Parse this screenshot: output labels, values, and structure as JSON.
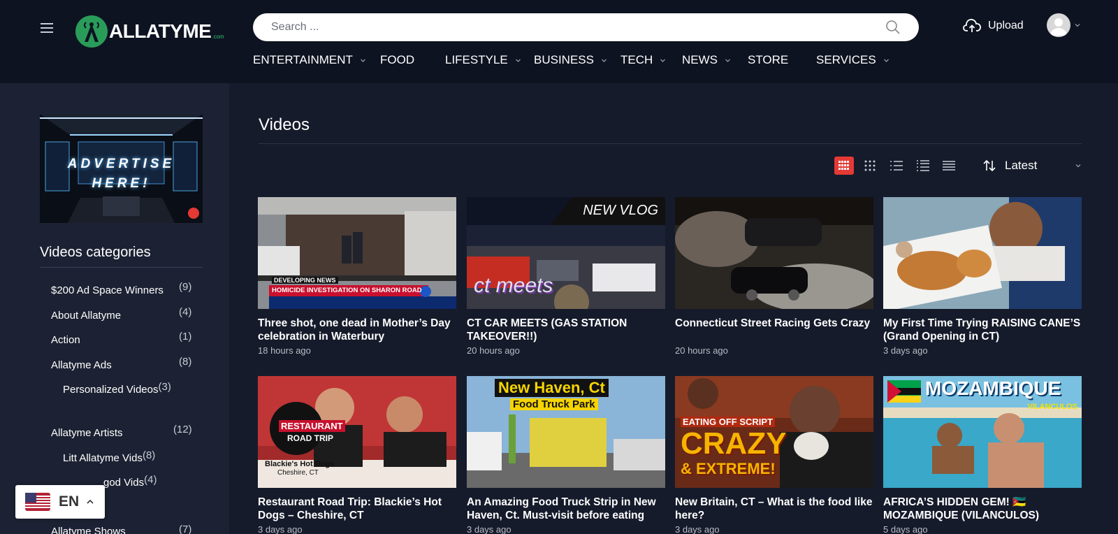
{
  "header": {
    "logo_text": "ALLATYME",
    "logo_suffix": ".com",
    "search_placeholder": "Search ...",
    "upload_label": "Upload"
  },
  "nav": [
    {
      "label": "ENTERTAINMENT",
      "has_dropdown": true
    },
    {
      "label": "FOOD",
      "has_dropdown": false
    },
    {
      "label": "LIFESTYLE",
      "has_dropdown": true
    },
    {
      "label": "BUSINESS",
      "has_dropdown": true
    },
    {
      "label": "TECH",
      "has_dropdown": true
    },
    {
      "label": "NEWS",
      "has_dropdown": true
    },
    {
      "label": "STORE",
      "has_dropdown": false
    },
    {
      "label": "SERVICES",
      "has_dropdown": true
    }
  ],
  "sidebar": {
    "ad_text_line1": "ADVERTISE",
    "ad_text_line2": "HERE!",
    "categories_title": "Videos categories",
    "categories": [
      {
        "label": "$200 Ad Space Winners",
        "count": "(9)"
      },
      {
        "label": "About Allatyme",
        "count": "(4)"
      },
      {
        "label": "Action",
        "count": "(1)"
      },
      {
        "label": "Allatyme Ads",
        "count": "(8)"
      },
      {
        "label": "Personalized Videos",
        "count": "(3)"
      },
      {
        "label": "Allatyme Artists",
        "count": "(12)"
      },
      {
        "label": "Litt Allatyme Vids",
        "count": "(8)"
      },
      {
        "label": "god Vids",
        "count": "(4)"
      },
      {
        "label": "Allatyme Shows",
        "count": "(7)"
      }
    ]
  },
  "main": {
    "title": "Videos",
    "sort_label": "Latest",
    "videos": [
      {
        "title": "Three shot, one dead in Mother’s Day celebration in Waterbury",
        "time": "18 hours ago"
      },
      {
        "title": "CT CAR MEETS (GAS STATION TAKEOVER!!)",
        "time": "20 hours ago"
      },
      {
        "title": "Connecticut Street Racing Gets Crazy",
        "time": "20 hours ago"
      },
      {
        "title": "My First Time Trying RAISING CANE’S (Grand Opening in CT)",
        "time": "3 days ago"
      },
      {
        "title": "Restaurant Road Trip: Blackie’s Hot Dogs – Cheshire, CT",
        "time": "3 days ago"
      },
      {
        "title": "An Amazing Food Truck Strip in New Haven, Ct. Must-visit before eating th…",
        "time": "3 days ago"
      },
      {
        "title": "New Britain, CT – What is the food like here?",
        "time": "3 days ago"
      },
      {
        "title": "AFRICA’S HIDDEN GEM! 🇲🇿 MOZAMBIQUE (VILANCULOS)",
        "time": "5 days ago"
      }
    ],
    "thumb_text": {
      "news_tag": "DEVELOPING NEWS",
      "news_headline": "HOMICIDE INVESTIGATION ON SHARON ROAD",
      "vlog_tag": "NEW VLOG",
      "car_meets": "ct meets",
      "restaurant": "RESTAURANT",
      "road_trip": "ROAD TRIP",
      "blackies": "Blackie's Hot Dogs",
      "cheshire": "Cheshire, CT",
      "new_haven": "New Haven, Ct",
      "food_truck_park": "Food Truck Park",
      "eating_off": "EATING OFF SCRIPT",
      "crazy": "CRAZY",
      "extreme": "& EXTREME!",
      "mozambique": "MOZAMBIQUE",
      "vilanculos": "VILANCULOS"
    }
  },
  "language": {
    "code": "EN"
  }
}
